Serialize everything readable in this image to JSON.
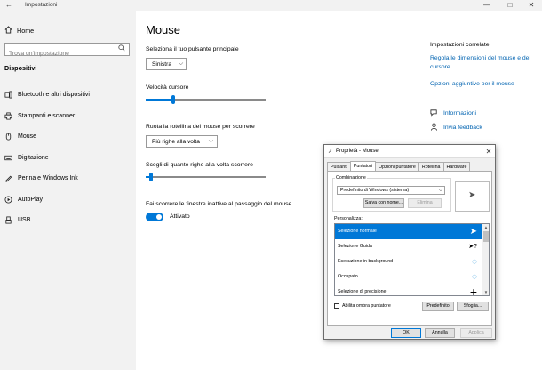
{
  "window": {
    "back_glyph": "←",
    "title": "Impostazioni",
    "minimize_glyph": "—",
    "maximize_glyph": "□",
    "close_glyph": "✕"
  },
  "sidebar": {
    "home_label": "Home",
    "search_placeholder": "Trova un'impostazione",
    "section_title": "Dispositivi",
    "items": [
      {
        "label": "Bluetooth e altri dispositivi",
        "icon": "bluetooth-icon"
      },
      {
        "label": "Stampanti e scanner",
        "icon": "printer-icon"
      },
      {
        "label": "Mouse",
        "icon": "mouse-icon"
      },
      {
        "label": "Digitazione",
        "icon": "keyboard-icon"
      },
      {
        "label": "Penna e Windows Ink",
        "icon": "pen-icon"
      },
      {
        "label": "AutoPlay",
        "icon": "autoplay-icon"
      },
      {
        "label": "USB",
        "icon": "usb-icon"
      }
    ]
  },
  "main": {
    "title": "Mouse",
    "primary_button_label": "Seleziona il tuo pulsante principale",
    "primary_button_value": "Sinistra",
    "cursor_speed_label": "Velocità cursore",
    "cursor_speed_level": 0.22,
    "wheel_label": "Ruota la rotellina del mouse per scorrere",
    "wheel_value": "Più righe alla volta",
    "lines_label": "Scegli di quante righe alla volta scorrere",
    "lines_level": 0.03,
    "inactive_scroll_label": "Fai scorrere le finestre inattive al passaggio del mouse",
    "inactive_scroll_state": "Attivato"
  },
  "related": {
    "title": "Impostazioni correlate",
    "link1": "Regola le dimensioni del mouse e del cursore",
    "link2": "Opzioni aggiuntive per il mouse",
    "info": "Informazioni",
    "feedback": "Invia feedback"
  },
  "dialog": {
    "title": "Proprietà - Mouse",
    "tabs": [
      "Pulsanti",
      "Puntatori",
      "Opzioni puntatore",
      "Rotellina",
      "Hardware"
    ],
    "active_tab": "Puntatori",
    "scheme_label": "Combinazione",
    "scheme_value": "Predefinito di Windows (sistema)",
    "save_as": "Salva con nome...",
    "delete": "Elimina",
    "customize_label": "Personalizza:",
    "cursors": [
      {
        "name": "Selezione normale",
        "glyph": "➤"
      },
      {
        "name": "Selezione Guida",
        "glyph": "➤?"
      },
      {
        "name": "Esecuzione in background",
        "glyph": "◌"
      },
      {
        "name": "Occupato",
        "glyph": "◌"
      },
      {
        "name": "Selezione di precisione",
        "glyph": "+"
      }
    ],
    "shadow_label": "Abilita ombra puntatore",
    "default_btn": "Predefinito",
    "browse_btn": "Sfoglia...",
    "ok": "OK",
    "cancel": "Annulla",
    "apply": "Applica"
  },
  "colors": {
    "accent": "#0078d7",
    "link": "#0063b1",
    "sidebar_bg": "#f2f2f2"
  }
}
